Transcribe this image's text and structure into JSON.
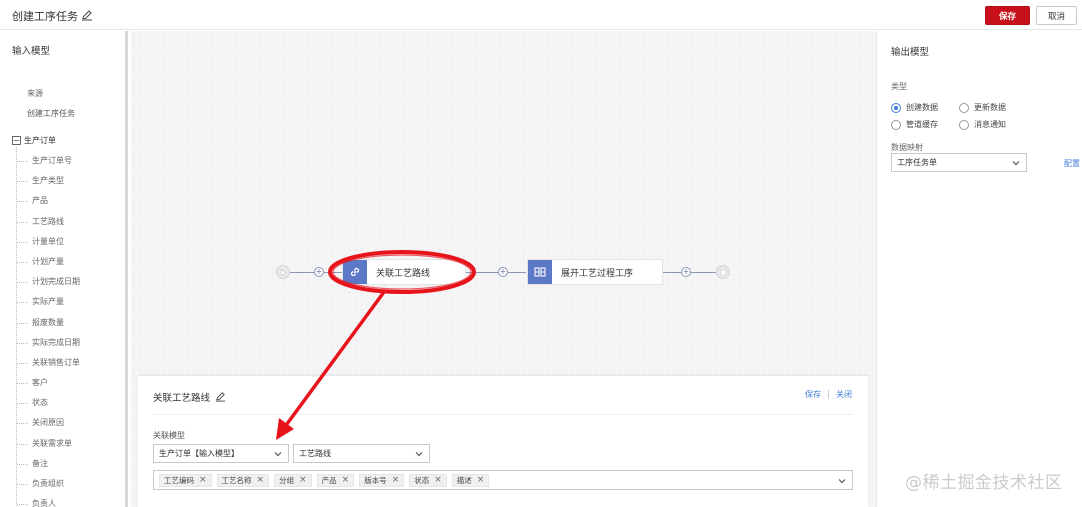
{
  "header": {
    "title": "创建工序任务",
    "save_label": "保存",
    "cancel_label": "取消"
  },
  "input_panel": {
    "title": "输入模型",
    "source_label": "来源",
    "source_value": "创建工序任务",
    "tree_root": "生产订单",
    "fields": [
      "生产订单号",
      "生产类型",
      "产品",
      "工艺路线",
      "计量单位",
      "计划产量",
      "计划完成日期",
      "实际产量",
      "报废数量",
      "实际完成日期",
      "关联销售订单",
      "客户",
      "状态",
      "关闭原因",
      "关联需求单",
      "备注",
      "负责组织",
      "负责人"
    ]
  },
  "flow": {
    "node1_label": "关联工艺路线",
    "node2_label": "展开工艺过程工序"
  },
  "detail": {
    "title": "关联工艺路线",
    "save_link": "保存",
    "close_link": "关闭",
    "model_label": "关联模型",
    "model_select": "生产订单【输入模型】",
    "field_select": "工艺路线",
    "tags": [
      "工艺编码",
      "工艺名称",
      "分组",
      "产品",
      "版本号",
      "状态",
      "描述"
    ]
  },
  "output_panel": {
    "title": "输出模型",
    "type_label": "类型",
    "options": [
      "创建数据",
      "更新数据",
      "管道缓存",
      "消息通知"
    ],
    "selected_option": "创建数据",
    "mapping_label": "数据映射",
    "mapping_select": "工序任务单",
    "config_link": "配置"
  },
  "watermark": "@稀土掘金技术社区",
  "colors": {
    "primary_button": "#c8101a",
    "link": "#3f7cd8",
    "node_icon": "#5b79c7",
    "annotation": "#e8141c"
  }
}
